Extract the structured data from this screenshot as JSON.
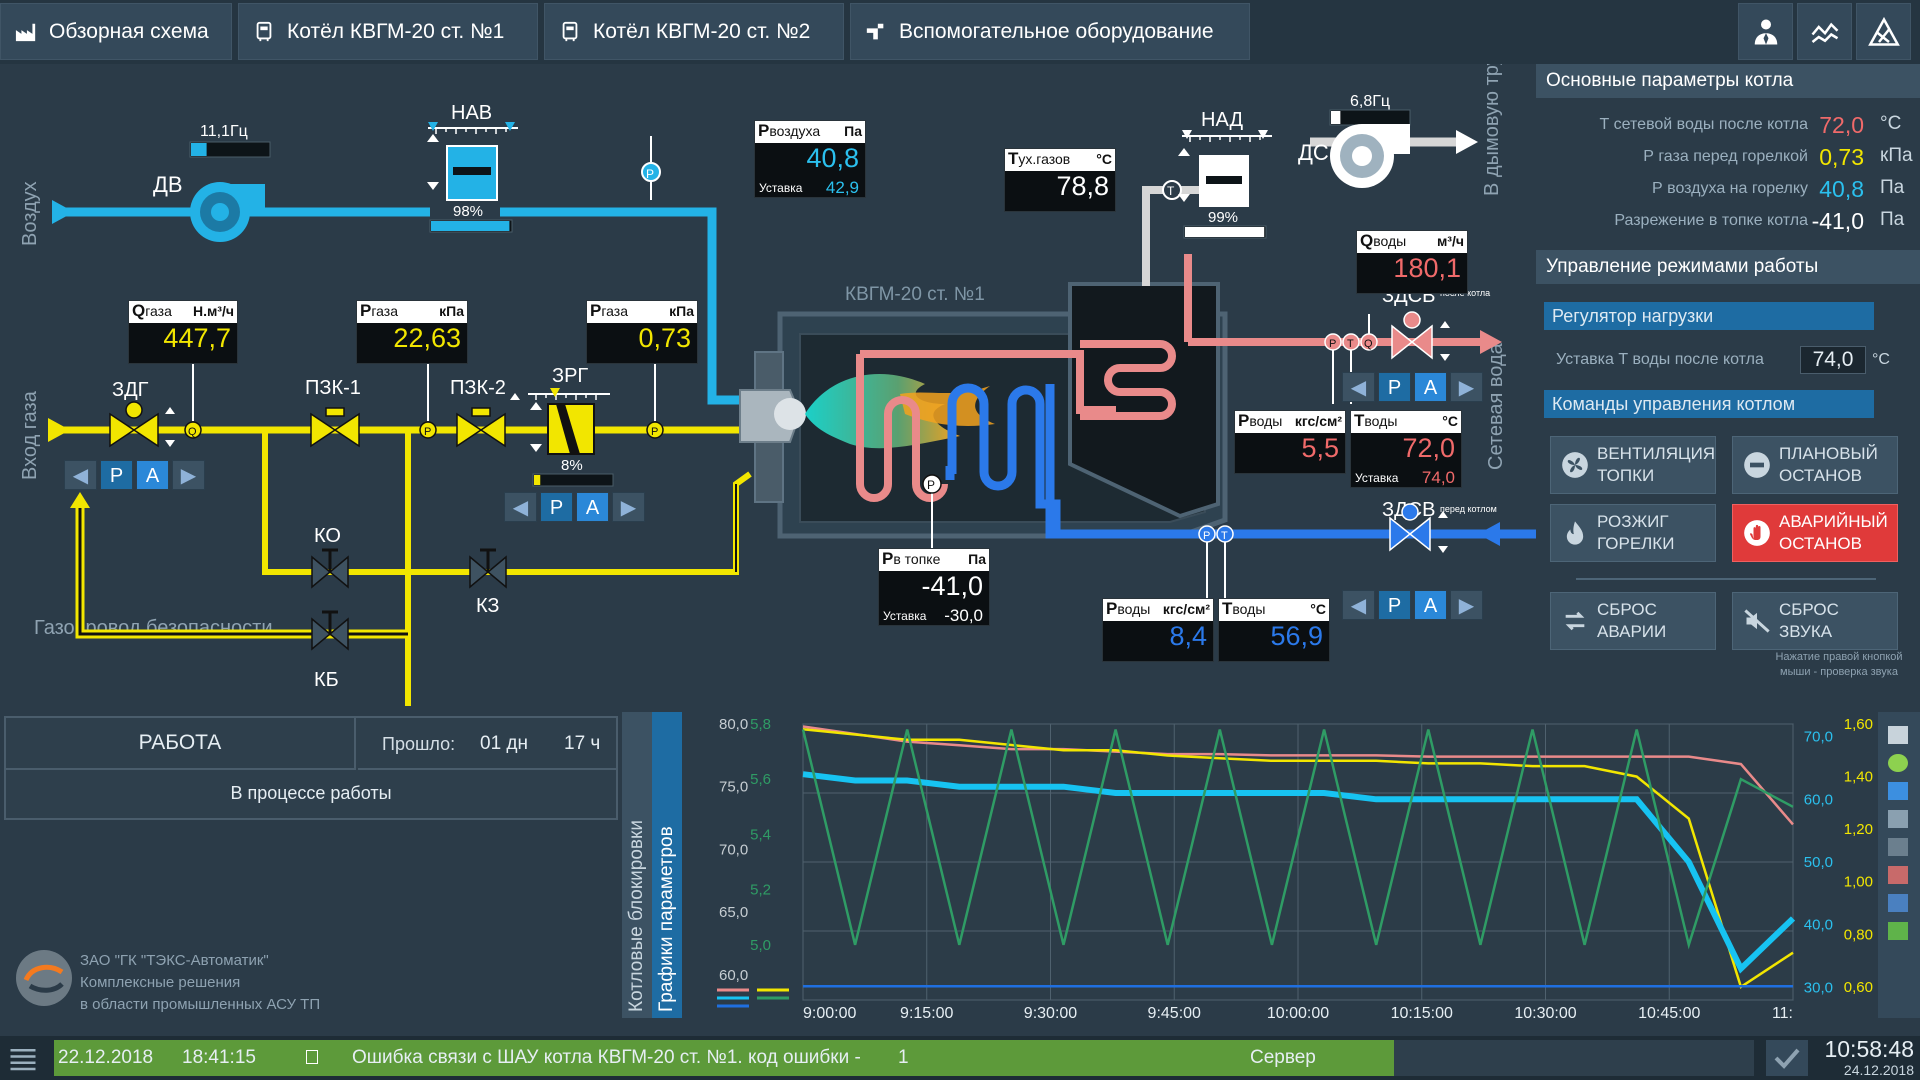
{
  "nav": {
    "tabs": [
      {
        "label": "Обзорная схема"
      },
      {
        "label": "Котёл КВГМ-20 ст. №1"
      },
      {
        "label": "Котёл КВГМ-20 ст. №2"
      },
      {
        "label": "Вспомогательное оборудование"
      }
    ],
    "tools": [
      "operators-icon",
      "trend-icon",
      "alarm-icon"
    ]
  },
  "mnemo": {
    "boiler_title": "КВГМ-20 ст. №1",
    "labels": {
      "air": "Воздух",
      "gas_in": "Вход газа",
      "safety_gas": "Газопровод безопасности",
      "to_chimney": "В дымовую трубу",
      "network_water": "Сетевая вода",
      "dv": "ДВ",
      "nav": "НАВ",
      "nad": "НАД",
      "ds": "ДС",
      "zdg": "ЗДГ",
      "pzk1": "ПЗК-1",
      "pzk2": "ПЗК-2",
      "zrg": "ЗРГ",
      "ko": "КО",
      "kz": "КЗ",
      "kb": "КБ",
      "zdsv_after": "ЗДСВ",
      "zdsv_after_sub": "после котла",
      "zdsv_before": "ЗДСВ",
      "zdsv_before_sub": "перед котлом"
    },
    "dv_freq": "11,1Гц",
    "ds_freq": "6,8Гц",
    "nav_pos": "98%",
    "nad_pos": "99%",
    "zrg_pos": "8%",
    "dv_level": 0.2,
    "nav_level": 0.98,
    "nad_level": 0.99,
    "zrg_level": 0.08,
    "ds_level": 0.12,
    "ctrl": {
      "left": "◀",
      "p": "Р",
      "a": "А",
      "right": "▶"
    },
    "sensor_letters": {
      "q": "Q",
      "p": "P",
      "t": "T"
    },
    "gauges": {
      "p_air": {
        "name": "Р",
        "sub": "воздуха",
        "unit": "Па",
        "value": "40,8",
        "setp_label": "Уставка",
        "setp": "42,9"
      },
      "t_gas": {
        "name": "Т",
        "sub": "ух.газов",
        "unit": "°С",
        "value": "78,8"
      },
      "q_gas": {
        "name": "Q",
        "sub": "газа",
        "unit": "Н.м³/ч",
        "value": "447,7"
      },
      "p_gas1": {
        "name": "Р",
        "sub": "газа",
        "unit": "кПа",
        "value": "22,63"
      },
      "p_gas2": {
        "name": "Р",
        "sub": "газа",
        "unit": "кПа",
        "value": "0,73"
      },
      "q_water": {
        "name": "Q",
        "sub": "воды",
        "unit": "м³/ч",
        "value": "180,1"
      },
      "p_water_out": {
        "name": "Р",
        "sub": "воды",
        "unit": "кгс/см²",
        "value": "5,5"
      },
      "t_water_out": {
        "name": "Т",
        "sub": "воды",
        "unit": "°С",
        "value": "72,0",
        "setp_label": "Уставка",
        "setp": "74,0"
      },
      "p_furnace": {
        "name": "Р",
        "sub": "в топке",
        "unit": "Па",
        "value": "-41,0",
        "setp_label": "Уставка",
        "setp": "-30,0"
      },
      "p_water_in": {
        "name": "Р",
        "sub": "воды",
        "unit": "кгс/см²",
        "value": "8,4"
      },
      "t_water_in": {
        "name": "Т",
        "sub": "воды",
        "unit": "°С",
        "value": "56,9"
      }
    }
  },
  "params": {
    "title": "Основные параметры котла",
    "rows": [
      {
        "label": "Т сетевой воды после котла",
        "value": "72,0",
        "unit": "°С",
        "color": "#f06a6a"
      },
      {
        "label": "Р газа перед горелкой",
        "value": "0,73",
        "unit": "кПа",
        "color": "#f2e600"
      },
      {
        "label": "Р воздуха на горелку",
        "value": "40,8",
        "unit": "Па",
        "color": "#2bc0ee"
      },
      {
        "label": "Разрежение в топке котла",
        "value": "-41,0",
        "unit": "Па",
        "color": "#ffffff"
      }
    ]
  },
  "modes": {
    "title": "Управление режимами работы",
    "regulator": "Регулятор нагрузки",
    "setp_label": "Уставка Т воды после котла",
    "setp_value": "74,0",
    "setp_unit": "°С",
    "commands_title": "Команды управления котлом",
    "commands": [
      {
        "label": "ВЕНТИЛЯЦИЯ ТОПКИ"
      },
      {
        "label": "ПЛАНОВЫЙ ОСТАНОВ"
      },
      {
        "label": "РОЗЖИГ ГОРЕЛКИ"
      },
      {
        "label": "АВАРИЙНЫЙ ОСТАНОВ"
      },
      {
        "label": "СБРОС АВАРИИ"
      },
      {
        "label": "СБРОС ЗВУКА"
      }
    ],
    "hint": "Нажатие правой кнопкой мыши - проверка звука"
  },
  "status": {
    "mode": "РАБОТА",
    "elapsed_label": "Прошло:",
    "days": "01 дн",
    "hours": "17 ч",
    "state": "В процессе работы"
  },
  "company": {
    "line1": "ЗАО \"ГК \"ТЭКС-Автоматик\"",
    "line2": "Комплексные решения",
    "line3": "в области промышленных АСУ ТП"
  },
  "trend_tabs": {
    "blocks": "Котловые блокировки",
    "graphs": "Графики параметров"
  },
  "chart_data": {
    "type": "line",
    "x": [
      "9:00:00",
      "9:15:00",
      "9:30:00",
      "9:45:00",
      "10:00:00",
      "10:15:00",
      "10:30:00",
      "10:45:00",
      "11:"
    ],
    "axes": [
      {
        "id": "t",
        "ticks": [
          "80,0",
          "75,0",
          "70,0",
          "65,0",
          "60,0"
        ],
        "range": [
          58,
          80
        ],
        "color": "#c6cdd2"
      },
      {
        "id": "p",
        "ticks": [
          "5,8",
          "5,6",
          "5,4",
          "5,2",
          "5,0"
        ],
        "range": [
          4.8,
          5.8
        ],
        "color": "#2f9c65"
      },
      {
        "id": "a",
        "ticks": [
          "70,0",
          "60,0",
          "50,0",
          "40,0",
          "30,0"
        ],
        "range": [
          28,
          72
        ],
        "color": "#2bc0ee"
      },
      {
        "id": "g",
        "ticks": [
          "1,60",
          "1,40",
          "1,20",
          "1,00",
          "0,80",
          "0,60"
        ],
        "range": [
          0.55,
          1.6
        ],
        "color": "#f2e600"
      }
    ],
    "series": [
      {
        "axis": "t",
        "color": "#e98a8a",
        "values": [
          79.8,
          79.2,
          78.6,
          78.3,
          78.0,
          78.0,
          77.8,
          77.6,
          77.6,
          77.5,
          77.5,
          77.5,
          77.4,
          77.4,
          77.4,
          77.4,
          77.4,
          77.4,
          76.8,
          72.0
        ]
      },
      {
        "axis": "g",
        "color": "#f2e600",
        "values": [
          1.58,
          1.56,
          1.54,
          1.54,
          1.52,
          1.5,
          1.5,
          1.48,
          1.47,
          1.46,
          1.46,
          1.46,
          1.45,
          1.45,
          1.44,
          1.44,
          1.4,
          1.24,
          0.6,
          0.73
        ]
      },
      {
        "axis": "a",
        "color": "#17c3f2",
        "values": [
          64,
          63,
          63,
          62,
          62,
          62,
          61,
          61,
          61,
          61,
          61,
          60,
          60,
          60,
          60,
          60,
          60,
          50,
          33,
          41
        ]
      },
      {
        "axis": "p",
        "color": "#2f9c65",
        "values": [
          5.78,
          5.0,
          5.78,
          5.0,
          5.78,
          5.0,
          5.78,
          5.0,
          5.78,
          5.0,
          5.78,
          5.0,
          5.78,
          5.0,
          5.78,
          5.0,
          5.78,
          5.0,
          5.6,
          5.5
        ]
      },
      {
        "axis": "p",
        "color": "#1f6fe0",
        "values": [
          4.85,
          4.85,
          4.85,
          4.85,
          4.85,
          4.85,
          4.85,
          4.85,
          4.85,
          4.85,
          4.85,
          4.85,
          4.85,
          4.85,
          4.85,
          4.85,
          4.85,
          4.85,
          4.85,
          4.85
        ]
      }
    ]
  },
  "bottombar": {
    "date": "22.12.2018",
    "time": "18:41:15",
    "message": "Ошибка связи с ШАУ котла КВГМ-20 ст. №1. код ошибки -",
    "code": "1",
    "source": "Сервер",
    "clock": "10:58:48",
    "clock_date": "24.12.2018"
  }
}
